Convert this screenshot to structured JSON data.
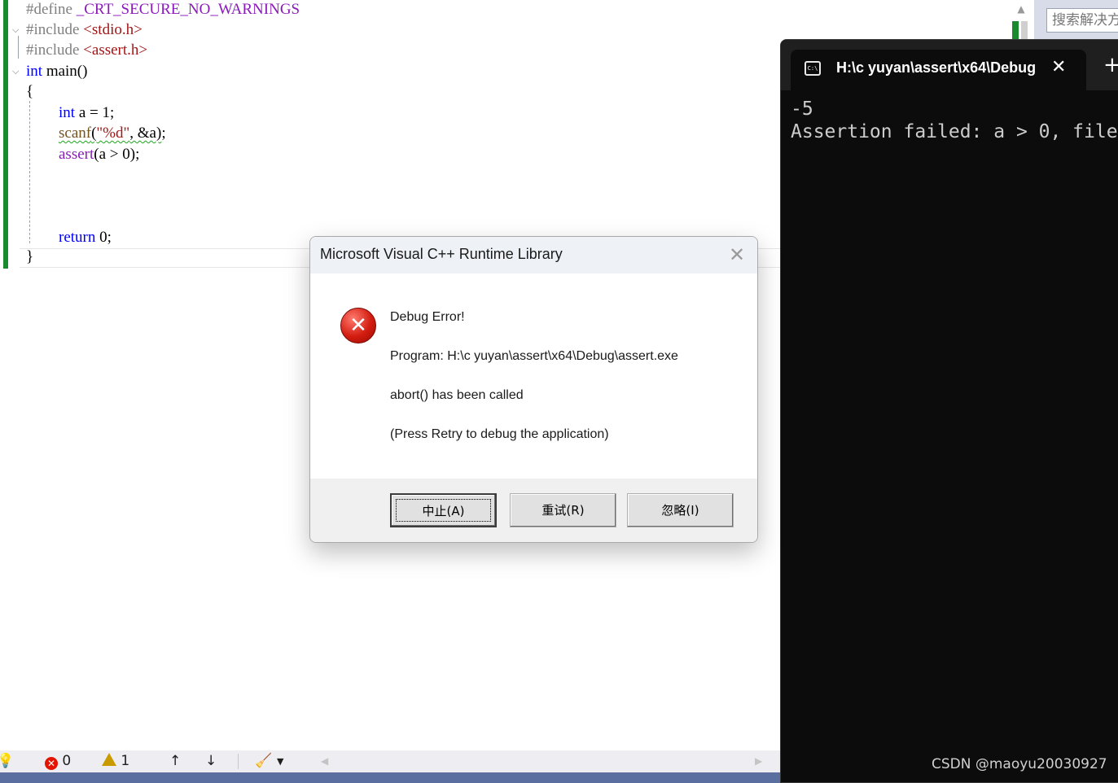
{
  "editor": {
    "lines": {
      "l1": {
        "pre": "#define",
        "macro": "_CRT_SECURE_NO_WARNINGS"
      },
      "l2": {
        "pre": "#include",
        "file": "<stdio.h>"
      },
      "l3": {
        "pre": "#include",
        "file": "<assert.h>"
      },
      "l4": {
        "type": "int",
        "name": "main()"
      },
      "l5": "{",
      "l6": {
        "type": "int",
        "rest": "a = 1;"
      },
      "l7": {
        "fn": "scanf",
        "open": "(",
        "str": "\"%d\"",
        "rest": ", &a)",
        "end": ";"
      },
      "l8": {
        "fn": "assert",
        "rest": "(a > 0);"
      },
      "l9": {
        "kw": "return",
        "rest": "0;"
      },
      "l10": "}"
    }
  },
  "ide_right": {
    "search_placeholder": "搜索解决方案资源管理器"
  },
  "terminal": {
    "tab_title": "H:\\c yuyan\\assert\\x64\\Debug",
    "icon_glyph": "C:\\",
    "close_glyph": "✕",
    "new_tab_glyph": "+",
    "output": [
      "-5",
      "Assertion failed: a > 0, file"
    ]
  },
  "statusbar": {
    "errors": "0",
    "warnings": "1",
    "up_arrow": "↑",
    "down_arrow": "↓"
  },
  "dialog": {
    "title": "Microsoft Visual C++ Runtime Library",
    "close_glyph": "✕",
    "heading": "Debug Error!",
    "program": "Program: H:\\c yuyan\\assert\\x64\\Debug\\assert.exe",
    "message": "abort() has been called",
    "hint": "(Press Retry to debug the application)",
    "buttons": {
      "abort": "中止(A)",
      "retry": "重试(R)",
      "ignore": "忽略(I)"
    }
  },
  "watermark": "CSDN @maoyu20030927",
  "colors": {
    "change_bar": "#1b8a2e",
    "keyword": "#0000ff",
    "terminal_bg": "#0c0c0c",
    "status_strip": "#5a6fa0",
    "error_red": "#e51400"
  }
}
